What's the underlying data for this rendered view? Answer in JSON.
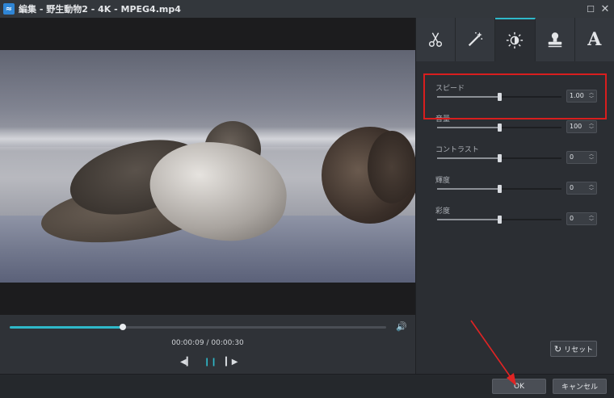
{
  "window": {
    "title": "編集 - 野生動物2 - 4K - MPEG4.mp4",
    "app_icon": "app-logo-icon"
  },
  "player": {
    "progress_fraction": 0.3,
    "timecode": "00:00:09 / 00:00:30",
    "icons": [
      "previous-frame-icon",
      "pause-icon",
      "next-frame-icon",
      "volume-icon"
    ]
  },
  "tabs": [
    {
      "name": "trim",
      "icon": "scissors-icon",
      "active": false
    },
    {
      "name": "effect",
      "icon": "magic-wand-icon",
      "active": false
    },
    {
      "name": "adjust",
      "icon": "brightness-icon",
      "active": true
    },
    {
      "name": "watermark",
      "icon": "stamp-icon",
      "active": false
    },
    {
      "name": "text",
      "icon": "text-icon",
      "label": "A",
      "active": false
    }
  ],
  "adjustments": [
    {
      "label": "スピード",
      "value": "1.00",
      "level": 0.5
    },
    {
      "label": "音量",
      "value": "100",
      "level": 0.5
    },
    {
      "label": "コントラスト",
      "value": "0",
      "level": 0.5
    },
    {
      "label": "輝度",
      "value": "0",
      "level": 0.5
    },
    {
      "label": "彩度",
      "value": "0",
      "level": 0.5
    }
  ],
  "reset_label": "リセット",
  "footer": {
    "ok_label": "OK",
    "cancel_label": "キャンセル"
  },
  "colors": {
    "accent": "#2fb8c9",
    "highlight": "#d81e1e"
  }
}
